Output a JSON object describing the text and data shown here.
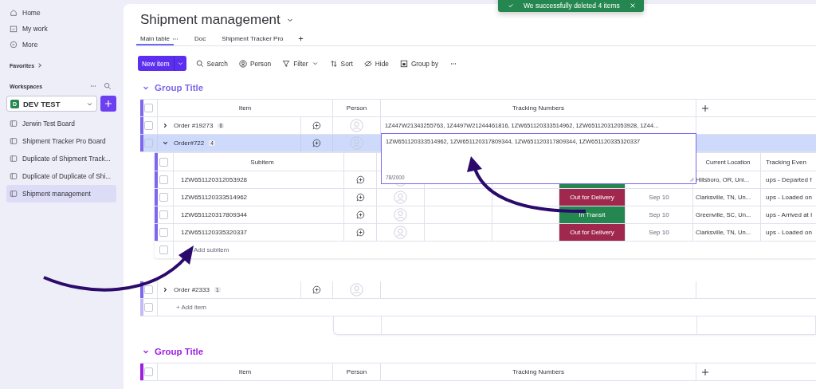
{
  "sidebar": {
    "nav": [
      {
        "kind": "home",
        "label": "Home"
      },
      {
        "kind": "work",
        "label": "My work"
      },
      {
        "kind": "more",
        "label": "More"
      }
    ],
    "favorites": "Favorites",
    "workspaces": "Workspaces",
    "workspace": {
      "badge": "D",
      "name": "DEV TEST"
    },
    "boards": [
      {
        "label": "Jerwin Test Board",
        "selected": false
      },
      {
        "label": "Shipment Tracker Pro Board",
        "selected": false
      },
      {
        "label": "Duplicate of Shipment Track...",
        "selected": false
      },
      {
        "label": "Duplicate of Duplicate of Shi...",
        "selected": false
      },
      {
        "label": "Shipment management",
        "selected": true
      }
    ]
  },
  "toast": {
    "message": "We successfully deleted 4 items"
  },
  "board": {
    "title": "Shipment management",
    "views": [
      {
        "label": "Main table",
        "selected": true
      },
      {
        "label": "Doc",
        "selected": false
      },
      {
        "label": "Shipment Tracker Pro",
        "selected": false
      }
    ],
    "new_item": "New item",
    "actions": [
      {
        "kind": "search",
        "label": "Search"
      },
      {
        "kind": "person",
        "label": "Person"
      },
      {
        "kind": "filter",
        "label": "Filter"
      },
      {
        "kind": "sort",
        "label": "Sort"
      },
      {
        "kind": "hide",
        "label": "Hide"
      },
      {
        "kind": "group",
        "label": "Group by"
      }
    ]
  },
  "groups": [
    {
      "title": "Group Title",
      "color": "#7b68ee",
      "checked": false,
      "columns": [
        "Item",
        "Person",
        "Tracking Numbers"
      ],
      "items": [
        {
          "name": "Order #19273",
          "count": "6",
          "checked": false,
          "expanded": false,
          "selected": false,
          "tracking": "1Z447W21343255763, 1Z4497W21244461816, 1ZW651120333514962, 1ZW651120312053928, 1Z44..."
        },
        {
          "name": "Order#722",
          "count": "4",
          "checked": false,
          "expanded": true,
          "selected": true,
          "editor": {
            "value": "1ZW651120333514962, 1ZW651120317809344, 1ZW651120317809344, 1ZW651120335320337",
            "counter": "78/2000"
          },
          "sub_checked": false,
          "sub_columns": [
            "Subitem",
            "Current Location",
            "Tracking Even"
          ],
          "subitems": [
            {
              "name": "1ZW651120312053928",
              "checked": false,
              "color": "#258750",
              "location": "Hillsboro, OR, Uni...",
              "event": "ups - Departed f"
            },
            {
              "name": "1ZW651120333514962",
              "checked": false,
              "status": "Out for Delivery",
              "color": "#a0284e",
              "date": "Sep 10",
              "location": "Clarksville, TN, Un...",
              "event": "ups - Loaded on"
            },
            {
              "name": "1ZW651120317809344",
              "checked": false,
              "status": "In Transit",
              "color": "#258750",
              "date": "Sep 10",
              "location": "Greenville, SC, Un...",
              "event": "ups - Arrived at I"
            },
            {
              "name": "1ZW651120335320337",
              "checked": false,
              "status": "Out for Delivery",
              "color": "#a0284e",
              "date": "Sep 10",
              "location": "Clarksville, TN, Un...",
              "event": "ups - Loaded on"
            }
          ],
          "add_subitem": "Add subitem",
          "add_subitem_checked": false
        },
        {
          "name": "Order #2333",
          "count": "1",
          "checked": false,
          "expanded": false,
          "selected": false
        }
      ],
      "add_item": "+ Add item",
      "add_item_checked": false
    },
    {
      "title": "Group Title",
      "color": "#9d1fe0",
      "checked": false,
      "columns": [
        "Item",
        "Person",
        "Tracking Numbers"
      ]
    }
  ]
}
